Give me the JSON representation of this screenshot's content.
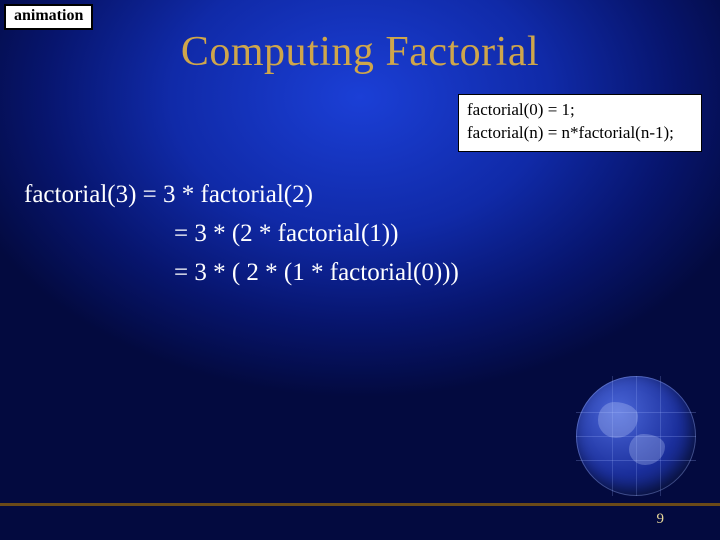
{
  "tag": "animation",
  "title": "Computing Factorial",
  "definition": {
    "line1": "factorial(0) = 1;",
    "line2": "factorial(n) = n*factorial(n-1);"
  },
  "expansion": {
    "line1": "factorial(3) = 3 * factorial(2)",
    "line2": "= 3 * (2 * factorial(1))",
    "line3": "= 3 * ( 2 * (1 * factorial(0)))"
  },
  "page_number": "9"
}
